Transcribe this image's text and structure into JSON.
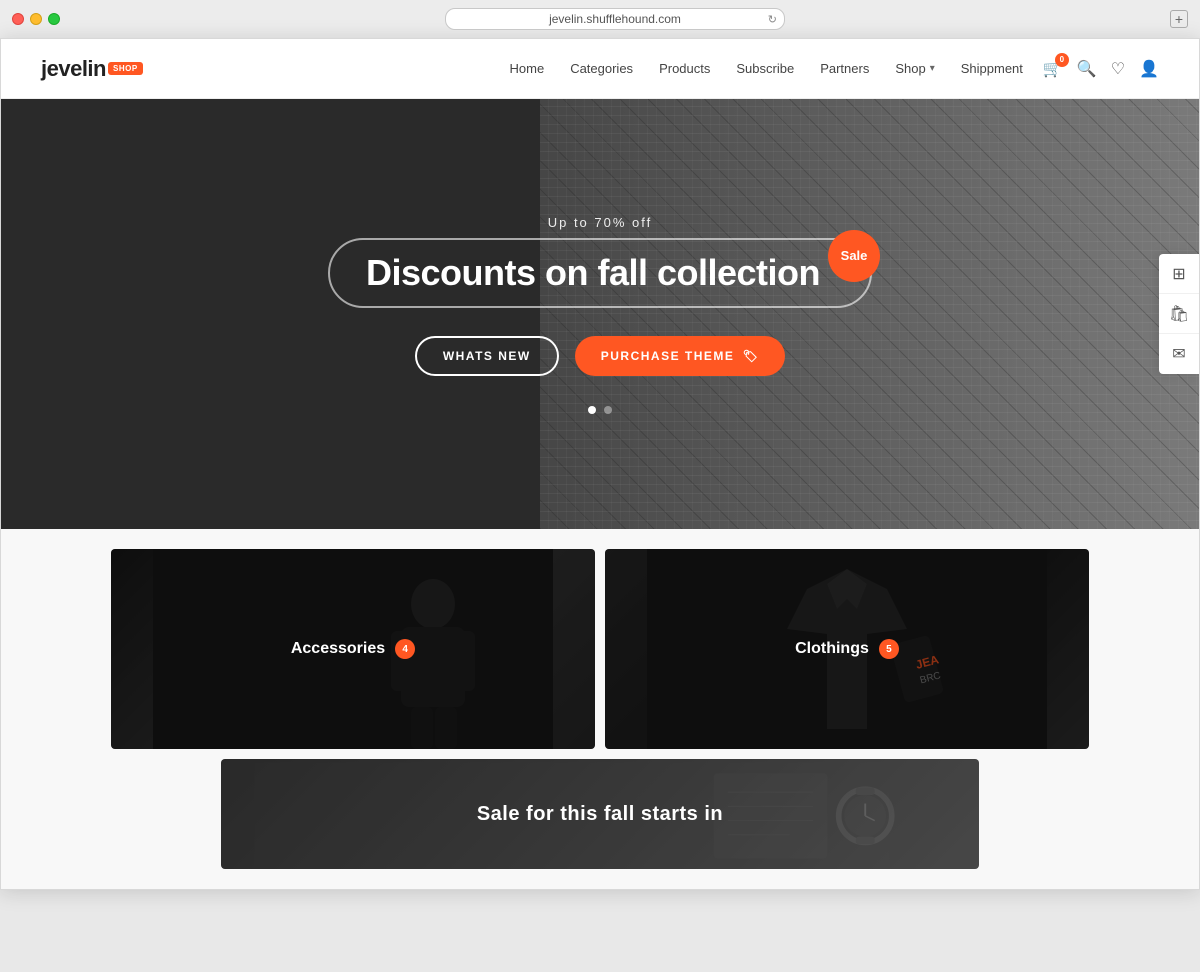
{
  "browser": {
    "url": "jevelin.shufflehound.com",
    "add_btn": "+"
  },
  "navbar": {
    "logo_text": "jevelin",
    "logo_badge": "SHOP",
    "links": [
      {
        "label": "Home",
        "id": "home"
      },
      {
        "label": "Categories",
        "id": "categories"
      },
      {
        "label": "Products",
        "id": "products"
      },
      {
        "label": "Subscribe",
        "id": "subscribe"
      },
      {
        "label": "Partners",
        "id": "partners"
      },
      {
        "label": "Shop",
        "id": "shop",
        "has_dropdown": true
      },
      {
        "label": "Shippment",
        "id": "shippment"
      }
    ],
    "cart_count": "0"
  },
  "hero": {
    "subtitle": "Up to 70% off",
    "title": "Discounts on fall collection",
    "sale_badge": "Sale",
    "btn_whats_new": "WHATS NEW",
    "btn_purchase": "PURCHASE THEME",
    "dots": [
      {
        "active": true
      },
      {
        "active": false
      }
    ]
  },
  "side_widgets": [
    {
      "icon": "layers",
      "label": "layers-icon"
    },
    {
      "icon": "bag",
      "label": "bag-icon"
    },
    {
      "icon": "envelope",
      "label": "envelope-icon"
    }
  ],
  "categories": [
    {
      "id": "accessories",
      "name": "Accessories",
      "count": "4"
    },
    {
      "id": "clothings",
      "name": "Clothings",
      "count": "5"
    }
  ],
  "fall_sale": {
    "text": "Sale for this fall starts in"
  }
}
